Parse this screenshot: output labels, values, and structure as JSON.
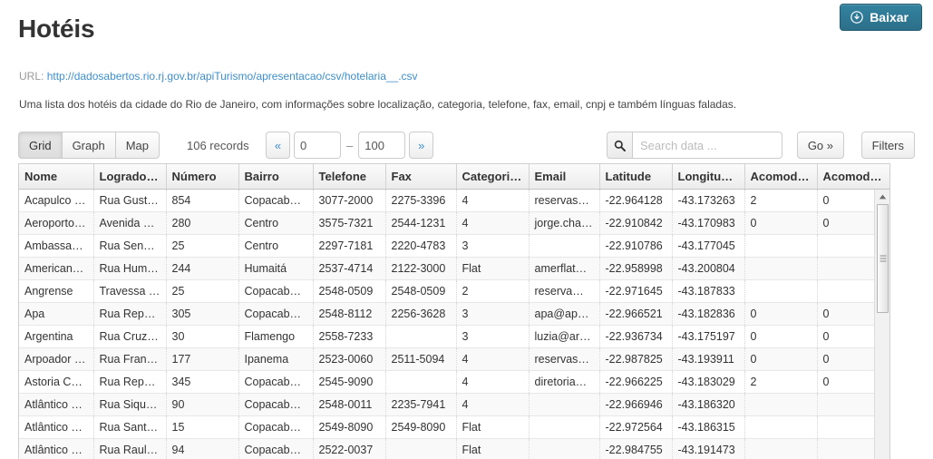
{
  "header": {
    "title": "Hotéis",
    "download_label": "Baixar",
    "download_icon": "download-circle-icon"
  },
  "meta": {
    "url_label": "URL:",
    "url_text": "http://dadosabertos.rio.rj.gov.br/apiTurismo/apresentacao/csv/hotelaria__.csv",
    "description": "Uma lista dos hotéis da cidade do Rio de Janeiro, com informações sobre localização, categoria, telefone, fax, email, cnpj e também línguas faladas."
  },
  "toolbar": {
    "views": [
      {
        "label": "Grid",
        "active": true
      },
      {
        "label": "Graph",
        "active": false
      },
      {
        "label": "Map",
        "active": false
      }
    ],
    "records_text": "106 records",
    "pager": {
      "prev_label": "«",
      "next_label": "»",
      "from_value": "0",
      "dash": "–",
      "to_value": "100"
    },
    "search": {
      "icon": "search-icon",
      "placeholder": "Search data ...",
      "value": ""
    },
    "go_label": "Go »",
    "filters_label": "Filters"
  },
  "table": {
    "columns": [
      "Nome",
      "Logrado…",
      "Número",
      "Bairro",
      "Telefone",
      "Fax",
      "Categori…",
      "Email",
      "Latitude",
      "Longitud…",
      "Acomod…",
      "Acomod…"
    ],
    "rows": [
      [
        "Acapulco …",
        "Rua Gust…",
        "854",
        "Copacaba…",
        "3077-2000",
        "2275-3396",
        "4",
        "reservas…",
        "-22.964128",
        "-43.173263",
        "2",
        "0"
      ],
      [
        "Aeroporto…",
        "Avenida B…",
        "280",
        "Centro",
        "3575-7321",
        "2544-1231",
        "4",
        "jorge.chav…",
        "-22.910842",
        "-43.170983",
        "0",
        "0"
      ],
      [
        "Ambassa…",
        "Rua Sena…",
        "25",
        "Centro",
        "2297-7181",
        "2220-4783",
        "3",
        "",
        "-22.910786",
        "-43.177045",
        "",
        ""
      ],
      [
        "American…",
        "Rua Hum…",
        "244",
        "Humaitá",
        "2537-4714",
        "2122-3000",
        "Flat",
        "amerflat…",
        "-22.958998",
        "-43.200804",
        "",
        ""
      ],
      [
        "Angrense",
        "Travessa …",
        "25",
        "Copacaba…",
        "2548-0509",
        "2548-0509",
        "2",
        "reserva@…",
        "-22.971645",
        "-43.187833",
        "",
        ""
      ],
      [
        "Apa",
        "Rua Repú…",
        "305",
        "Copacaba…",
        "2548-8112",
        "2256-3628",
        "3",
        "apa@apa…",
        "-22.966521",
        "-43.182836",
        "0",
        "0"
      ],
      [
        "Argentina",
        "Rua Cruz …",
        "30",
        "Flamengo",
        "2558-7233",
        "",
        "3",
        "luzia@arg…",
        "-22.936734",
        "-43.175197",
        "0",
        "0"
      ],
      [
        "Arpoador …",
        "Rua Fran…",
        "177",
        "Ipanema",
        "2523-0060",
        "2511-5094",
        "4",
        "reservas…",
        "-22.987825",
        "-43.193911",
        "0",
        "0"
      ],
      [
        "Astoria C…",
        "Rua Repú…",
        "345",
        "Copacaba…",
        "2545-9090",
        "",
        "4",
        "diretoria…",
        "-22.966225",
        "-43.183029",
        "2",
        "0"
      ],
      [
        "Atlântico …",
        "Rua Siqu…",
        "90",
        "Copacaba…",
        "2548-0011",
        "2235-7941",
        "4",
        "",
        "-22.966946",
        "-43.186320",
        "",
        ""
      ],
      [
        "Atlântico …",
        "Rua Sant…",
        "15",
        "Copacaba…",
        "2549-8090",
        "2549-8090",
        "Flat",
        "",
        "-22.972564",
        "-43.186315",
        "",
        ""
      ],
      [
        "Atlântico …",
        "Rua Raul …",
        "94",
        "Copacaba…",
        "2522-0037",
        "",
        "Flat",
        "",
        "-22.984755",
        "-43.191473",
        "",
        ""
      ]
    ]
  },
  "colors": {
    "accent": "#2c6f89",
    "link": "#3e8fcd",
    "header_text": "#333333"
  }
}
